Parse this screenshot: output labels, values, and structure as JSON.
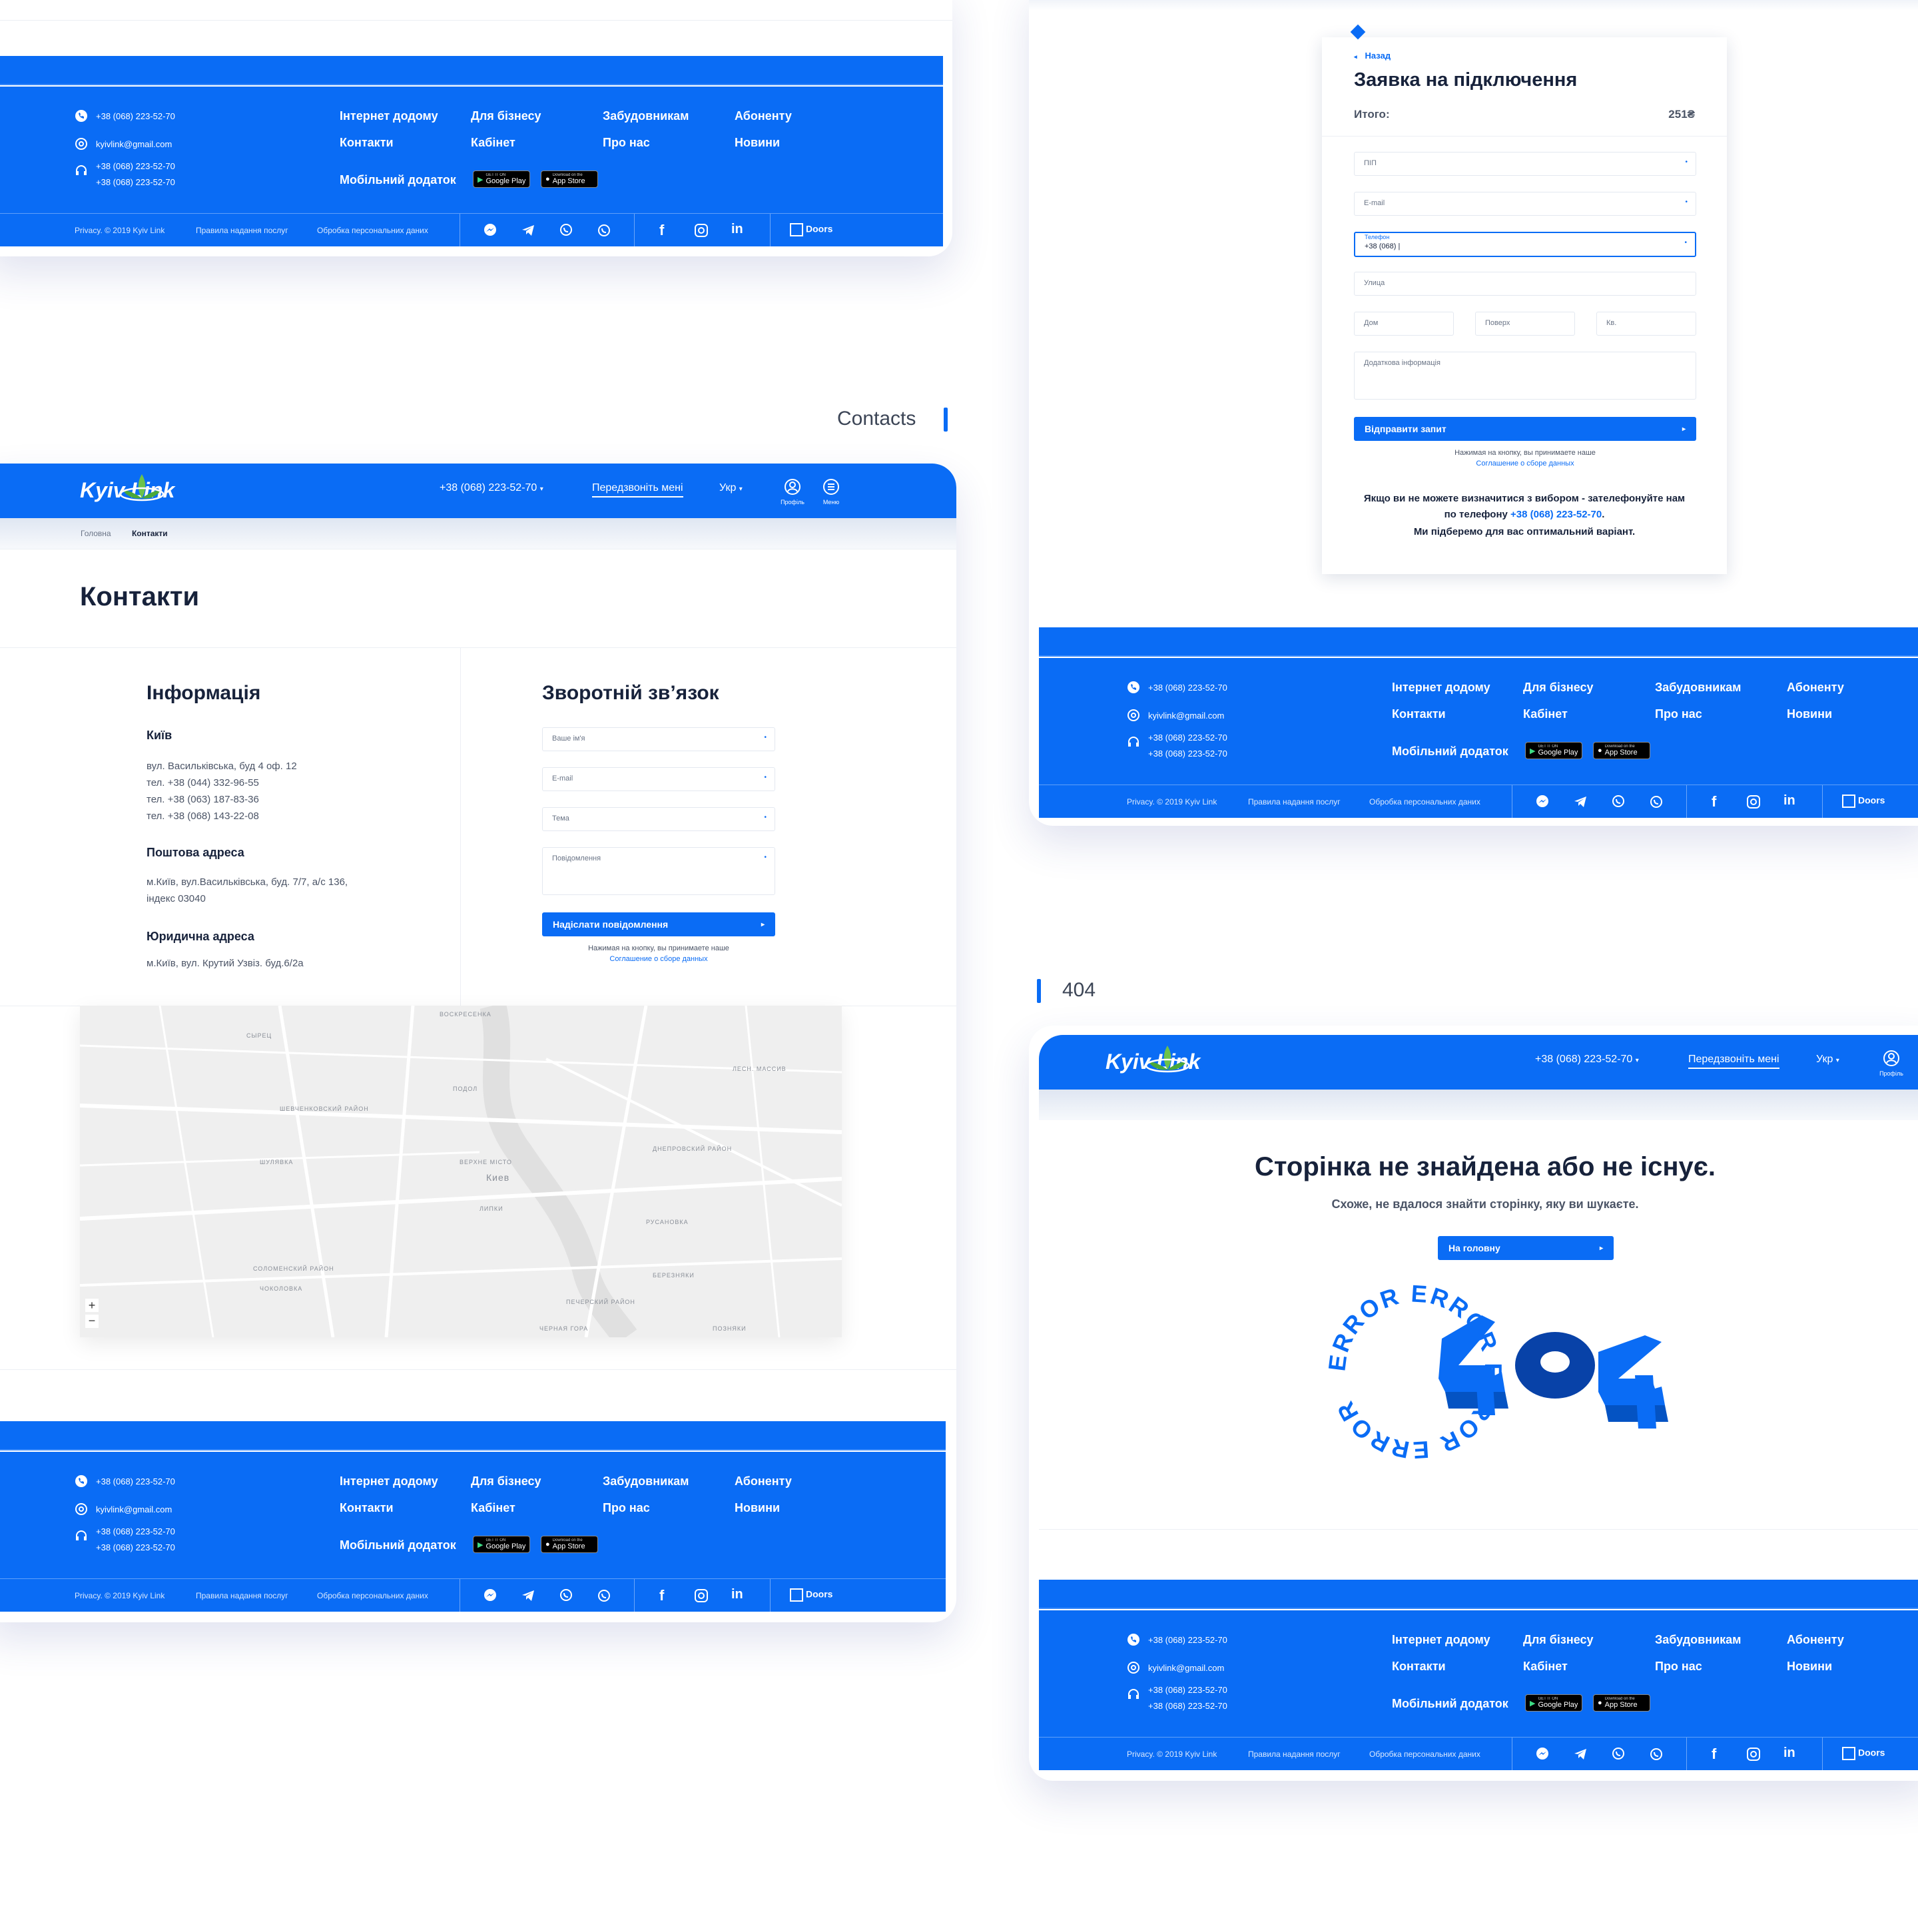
{
  "colors": {
    "brand": "#0a6cf5",
    "text_dark": "#17223b",
    "text_gray": "#6a7486",
    "map_bg": "#efefef"
  },
  "section_labels": {
    "contacts": "Contacts",
    "not_found": "404"
  },
  "brand": {
    "logo": "Kyiv Link"
  },
  "header": {
    "phone": "+38 (068) 223-52-70",
    "callback": "Передзвоніть мені",
    "lang": "Укр",
    "profile": "Профіль",
    "menu": "Меню"
  },
  "footer": {
    "phone": "+38 (068) 223-52-70",
    "email": "kyivlink@gmail.com",
    "support_phone_1": "+38 (068) 223-52-70",
    "support_phone_2": "+38 (068) 223-52-70",
    "links_row1": [
      "Інтернет додому",
      "Для бізнесу",
      "Забудовникам",
      "Абоненту"
    ],
    "links_row2": [
      "Контакти",
      "Кабінет",
      "Про нас",
      "Новини"
    ],
    "mobile_app": "Мобільний додаток",
    "google_play_small": "GET IT ON",
    "google_play": "Google Play",
    "app_store_small": "Download on the",
    "app_store": "App Store",
    "copyright": "Privacy. © 2019 Kyiv Link",
    "terms": "Правила надання послуг",
    "privacy": "Обробка персональних даних",
    "developer": "Doors",
    "developer_small": "Development"
  },
  "contacts_page": {
    "breadcrumb_home": "Головна",
    "breadcrumb_current": "Контакти",
    "title": "Контакти",
    "info_title": "Інформація",
    "city": "Київ",
    "address_lines": [
      "вул. Васильківська, буд 4 оф. 12",
      "тел. +38 (044) 332-96-55",
      "тел. +38 (063) 187-83-36",
      "тел. +38 (068) 143-22-08"
    ],
    "postal_title": "Поштова адреса",
    "postal_lines": [
      "м.Київ, вул.Васильківська, буд. 7/7, а/с 136,",
      "індекс 03040"
    ],
    "legal_title": "Юридична адреса",
    "legal_line": "м.Київ, вул. Крутий Узвіз. буд.6/2а",
    "feedback_title": "Зворотній зв’язок",
    "field_name": "Ваше ім'я",
    "field_email": "E-mail",
    "field_subject": "Тема",
    "field_message": "Повідомлення",
    "submit": "Надіслати повідомлення",
    "consent_1": "Нажимая на кнопку, вы принимаете наше",
    "consent_2": "Соглашение о сборе данных",
    "map_labels": [
      "ВОСКРЕСЕНКА",
      "СЫРЕЦ",
      "ЛЕСН. МАССИВ",
      "ПОДОЛ",
      "ШЕВЧЕНКОВСКИЙ РАЙОН",
      "ДНЕПРОВСКИЙ РАЙОН",
      "ВЕРХНЕ МІСТО",
      "Киев",
      "ЛИПКИ",
      "РУСАНОВКА",
      "СОЛОМЕНСКИЙ РАЙОН",
      "БЕРЕЗНЯКИ",
      "ЧОКОЛОВКА",
      "ПЕЧЕРСКИЙ РАЙОН",
      "ЧЕРНАЯ ГОРА",
      "ПОЗНЯКИ",
      "ШУЛЯВКА"
    ],
    "zoom_in": "+",
    "zoom_out": "−"
  },
  "application_page": {
    "back": "Назад",
    "title": "Заявка на підключення",
    "total_label": "Итого:",
    "total_value": "251₴",
    "field_name": "ПІП",
    "field_email": "E-mail",
    "phone_label": "Телефон",
    "phone_value": "+38 (068) |",
    "field_street": "Улица",
    "field_house": "Дом",
    "field_floor": "Поверх",
    "field_apt": "Кв.",
    "field_extra": "Додаткова інформація",
    "submit": "Відправити запит",
    "consent_1": "Нажимая на кнопку, вы принимаете наше",
    "consent_2": "Соглашение о сборе данных",
    "help_1": "Якщо ви не можете визначитися з вибором - зателефонуйте нам",
    "help_2a": "по телефону ",
    "help_2_phone": "+38 (068) 223-52-70",
    "help_2b": ".",
    "help_3": "Ми підберемо для вас оптимальний варіант."
  },
  "error_page": {
    "title": "Сторінка не знайдена або не існує.",
    "subtitle": "Схоже, не вдалося знайти сторінку, яку ви шукаєте.",
    "button": "На головну",
    "big_text": "404",
    "ring_text": "ERROR ERROR ERROR ERROR "
  }
}
